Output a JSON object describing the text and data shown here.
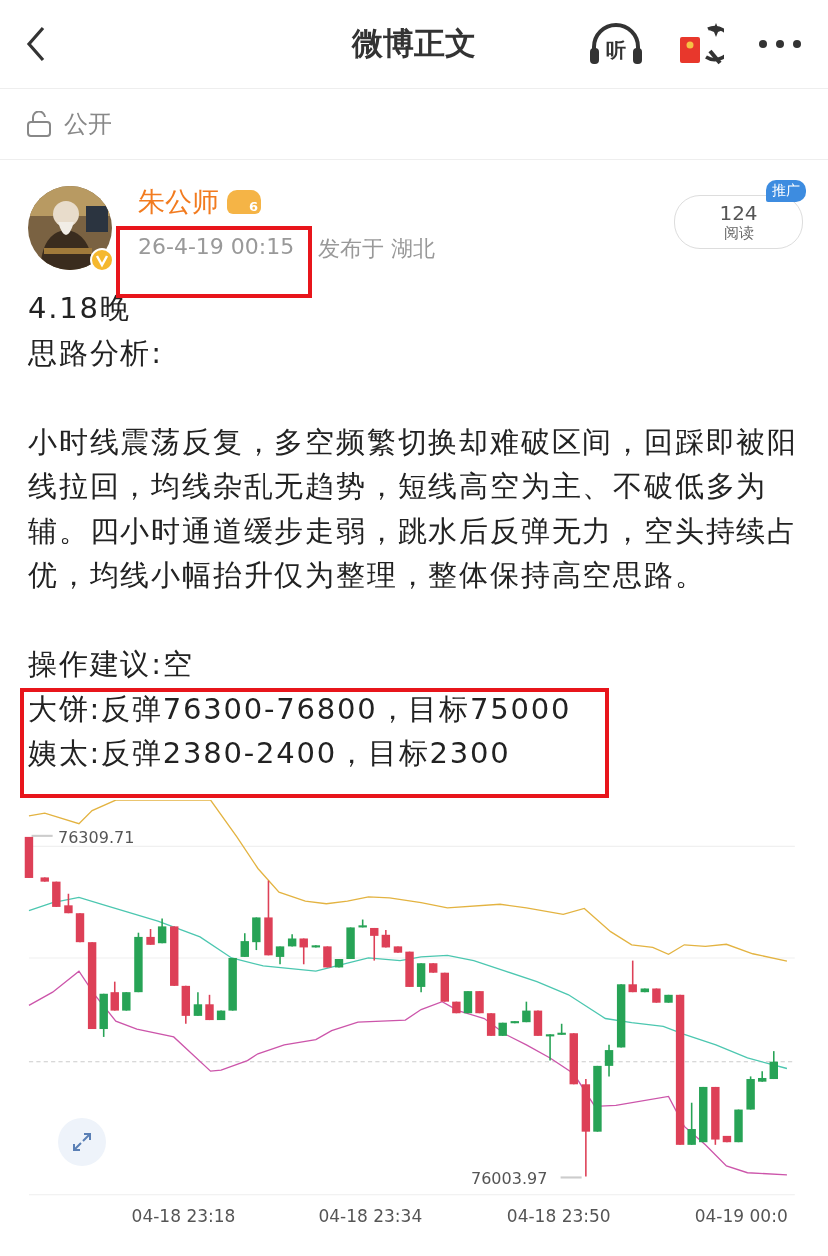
{
  "nav": {
    "title": "微博正文",
    "listen_label": "听"
  },
  "visibility": {
    "label": "公开"
  },
  "post": {
    "author": "朱公师",
    "level_badge": "6",
    "time": "26-4-19 00:15",
    "location": "发布于 湖北",
    "reads": {
      "count": "124",
      "label": "阅读",
      "badge": "推广"
    },
    "lines": [
      {
        "kind": "text",
        "text": "4.18晚"
      },
      {
        "kind": "text",
        "text": "思路分析:"
      },
      {
        "kind": "gap"
      },
      {
        "kind": "text",
        "text": "小时线震荡反复，多空频繁切换却难破区间，回踩即被阳线拉回，均线杂乱无趋势，短线高空为主、不破低多为辅。四小时通道缓步走弱，跳水后反弹无力，空头持续占优，均线小幅抬升仅为整理，整体保持高空思路。"
      },
      {
        "kind": "gap"
      },
      {
        "kind": "text",
        "text": "操作建议:空"
      },
      {
        "kind": "text",
        "text": "大饼:反弹76300-76800，目标75000"
      },
      {
        "kind": "text",
        "text": "姨太:反弹2380-2400，目标2300"
      }
    ],
    "chart": {
      "high_label": "76309.71",
      "low_label": "76003.97",
      "x_labels": [
        "04-18 23:18",
        "04-18 23:34",
        "04-18 23:50",
        "04-19 00:0"
      ]
    }
  }
}
